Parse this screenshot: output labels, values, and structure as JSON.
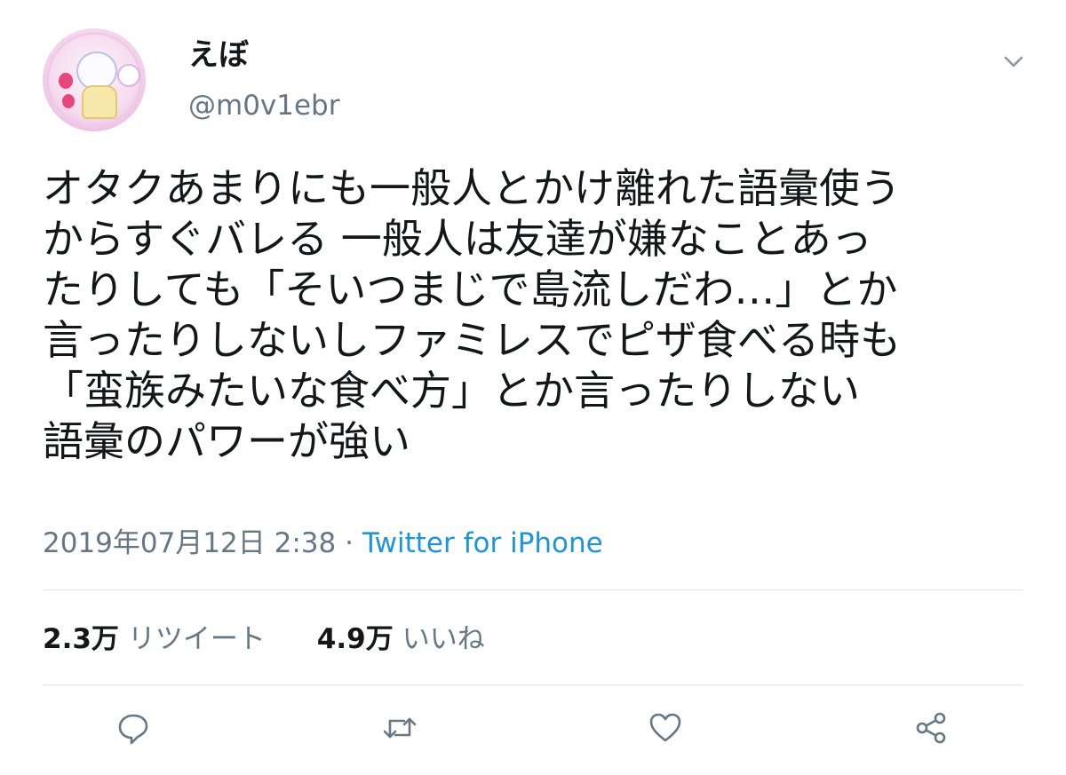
{
  "tweet": {
    "display_name": "えぼ",
    "handle": "@m0v1ebr",
    "text": "オタクあまりにも一般人とかけ離れた語彙使う\nからすぐバレる 一般人は友達が嫌なことあっ\nたりしても「そいつまじで島流しだわ…」とか\n言ったりしないしファミレスでピザ食べる時も\n「蛮族みたいな食べ方」とか言ったりしない\n語彙のパワーが強い",
    "timestamp": "2019年07月12日 2:38",
    "separator": "·",
    "source": "Twitter for iPhone",
    "stats": {
      "retweets_count": "2.3万",
      "retweets_label": "リツイート",
      "likes_count": "4.9万",
      "likes_label": "いいね"
    }
  },
  "icons": {
    "avatar": "avatar-image",
    "menu": "chevron-down-icon",
    "reply": "reply-icon",
    "retweet": "retweet-icon",
    "like": "heart-icon",
    "share": "share-icon"
  },
  "colors": {
    "text": "#14171a",
    "secondary": "#657786",
    "link": "#1b95e0",
    "divider": "#e1e8ed",
    "icon": "#657786"
  }
}
